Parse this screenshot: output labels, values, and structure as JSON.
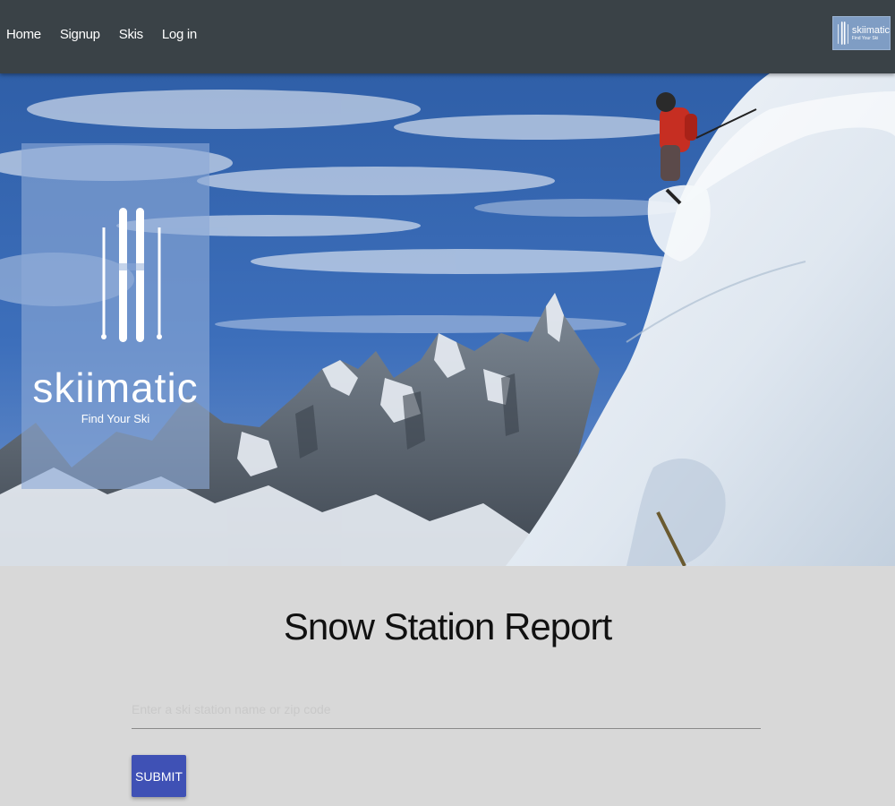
{
  "nav": {
    "links": [
      "Home",
      "Signup",
      "Skis",
      "Log in"
    ],
    "logo": {
      "name": "skiimatic",
      "tagline": "Find Your Ski"
    }
  },
  "hero": {
    "logo": {
      "name": "skiimatic",
      "tagline": "Find Your Ski"
    }
  },
  "main": {
    "title": "Snow Station Report",
    "input": {
      "value": "",
      "placeholder": "Enter a ski station name or zip code"
    },
    "submit_label": "SUBMIT"
  },
  "colors": {
    "navbar": "#3a4247",
    "button": "#3f51b5",
    "background": "#d8d8d8"
  },
  "icons": [
    "skis-logo-icon"
  ]
}
